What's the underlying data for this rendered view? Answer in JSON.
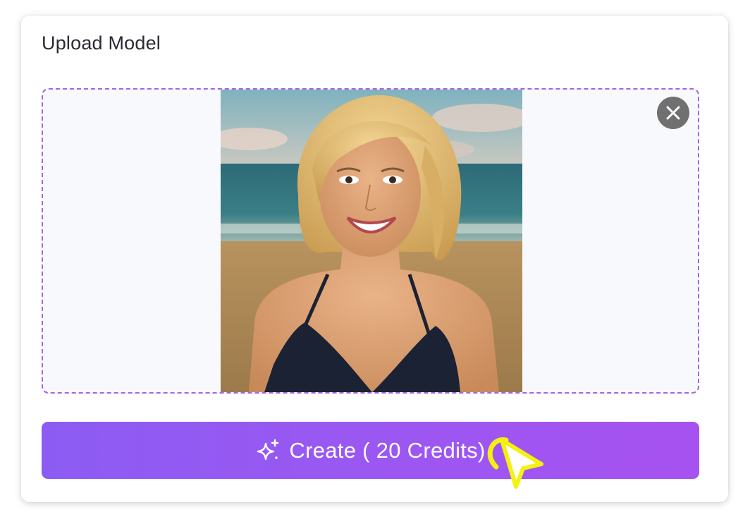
{
  "panel": {
    "title": "Upload Model"
  },
  "upload": {
    "image_alt": "Uploaded model photo: smiling blonde woman in a black halter top on a beach",
    "remove_icon": "close-icon"
  },
  "actions": {
    "create_label": "Create ( 20 Credits)",
    "create_icon": "sparkle-icon",
    "accent_start": "#8c5cf2",
    "accent_end": "#a652f0"
  },
  "colors": {
    "dropzone_border": "#a862e6",
    "cursor_highlight": "#f4f10f"
  }
}
